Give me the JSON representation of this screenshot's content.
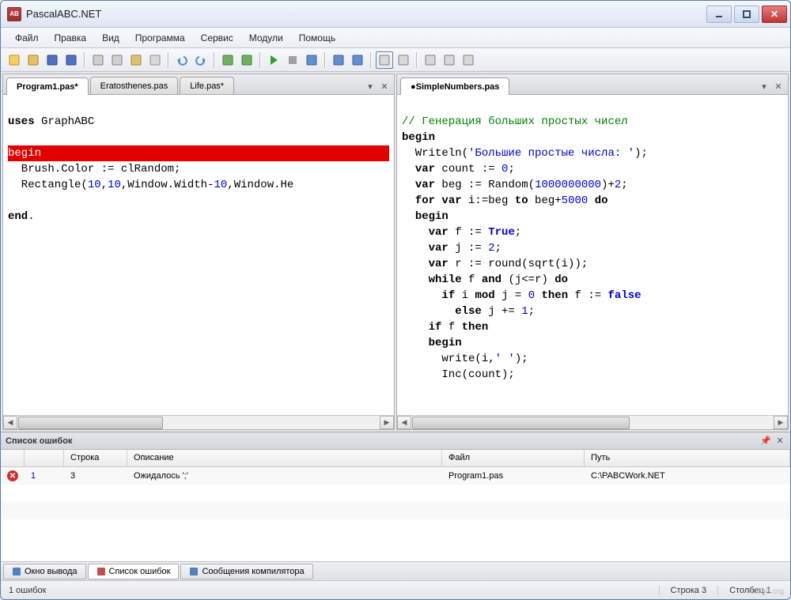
{
  "title": "PascalABC.NET",
  "menu": [
    "Файл",
    "Правка",
    "Вид",
    "Программа",
    "Сервис",
    "Модули",
    "Помощь"
  ],
  "toolbar_icons": [
    {
      "name": "new-file-icon",
      "fill": "#f4d060",
      "stroke": "#c09020"
    },
    {
      "name": "open-icon",
      "fill": "#e8c060",
      "stroke": "#b08020"
    },
    {
      "name": "save-icon",
      "fill": "#5070c0",
      "stroke": "#304090"
    },
    {
      "name": "save-all-icon",
      "fill": "#5070c0",
      "stroke": "#304090"
    },
    {
      "sep": true
    },
    {
      "name": "cut-icon",
      "fill": "#d0d0d0",
      "stroke": "#808080"
    },
    {
      "name": "copy-icon",
      "fill": "#d0d0d0",
      "stroke": "#808080"
    },
    {
      "name": "paste-icon",
      "fill": "#e0c070",
      "stroke": "#a08040"
    },
    {
      "name": "duplicate-icon",
      "fill": "#d8d8d8",
      "stroke": "#909090"
    },
    {
      "sep": true
    },
    {
      "name": "undo-icon",
      "fill": "#5090d0",
      "stroke": "#306090"
    },
    {
      "name": "redo-icon",
      "fill": "#5090d0",
      "stroke": "#306090"
    },
    {
      "sep": true
    },
    {
      "name": "compile-icon",
      "fill": "#70b060",
      "stroke": "#408030"
    },
    {
      "name": "build-icon",
      "fill": "#70b060",
      "stroke": "#408030"
    },
    {
      "sep": true
    },
    {
      "name": "run-icon",
      "fill": "#30a030",
      "stroke": "#207020"
    },
    {
      "name": "stop-icon",
      "fill": "#a0a0a0",
      "stroke": "#707070"
    },
    {
      "name": "step-icon",
      "fill": "#6090d0",
      "stroke": "#406090"
    },
    {
      "sep": true
    },
    {
      "name": "step-into-icon",
      "fill": "#6090d0",
      "stroke": "#406090"
    },
    {
      "name": "step-over-icon",
      "fill": "#6090d0",
      "stroke": "#406090"
    },
    {
      "sep": true
    },
    {
      "name": "console-icon",
      "fill": "#d8d8d8",
      "stroke": "#808080",
      "boxed": true
    },
    {
      "name": "form-icon",
      "fill": "#d8d8d8",
      "stroke": "#808080"
    },
    {
      "sep": true
    },
    {
      "name": "page1-icon",
      "fill": "#d8d8d8",
      "stroke": "#808080"
    },
    {
      "name": "page2-icon",
      "fill": "#d8d8d8",
      "stroke": "#808080"
    },
    {
      "name": "page3-icon",
      "fill": "#d8d8d8",
      "stroke": "#808080"
    }
  ],
  "left_tabs": [
    {
      "label": "Program1.pas*",
      "active": true
    },
    {
      "label": "Eratosthenes.pas",
      "active": false
    },
    {
      "label": "Life.pas*",
      "active": false
    }
  ],
  "right_tabs": [
    {
      "label": "●SimpleNumbers.pas",
      "active": true
    }
  ],
  "left_code": {
    "l1": "uses GraphABC",
    "l2": "",
    "l3": "begin",
    "l4": "  Brush.Color := clRandom;",
    "l5": "  Rectangle(10,10,Window.Width-10,Window.He",
    "l6": "",
    "l7": "end."
  },
  "right_code": {
    "comment": "// Генерация больших простых чисел",
    "l2": "begin",
    "l3_a": "  Writeln(",
    "l3_s": "'Большие простые числа: '",
    "l3_b": ");",
    "l4_a": "  ",
    "l4_kw": "var",
    "l4_b": " count := ",
    "l4_n": "0",
    "l4_c": ";",
    "l5_a": "  ",
    "l5_kw": "var",
    "l5_b": " beg := Random(",
    "l5_n": "1000000000",
    "l5_c": ")+",
    "l5_n2": "2",
    "l5_d": ";",
    "l6_a": "  ",
    "l6_kw": "for var",
    "l6_b": " i:=beg ",
    "l6_kw2": "to",
    "l6_c": " beg+",
    "l6_n": "5000",
    "l6_d": " ",
    "l6_kw3": "do",
    "l7": "  begin",
    "l8_a": "    ",
    "l8_kw": "var",
    "l8_b": " f := ",
    "l8_v": "True",
    "l8_c": ";",
    "l9_a": "    ",
    "l9_kw": "var",
    "l9_b": " j := ",
    "l9_n": "2",
    "l9_c": ";",
    "l10_a": "    ",
    "l10_kw": "var",
    "l10_b": " r := round(sqrt(i));",
    "l11_a": "    ",
    "l11_kw": "while",
    "l11_b": " f ",
    "l11_kw2": "and",
    "l11_c": " (j<=r) ",
    "l11_kw3": "do",
    "l12_a": "      ",
    "l12_kw": "if",
    "l12_b": " i ",
    "l12_kw2": "mod",
    "l12_c": " j = ",
    "l12_n": "0",
    "l12_d": " ",
    "l12_kw3": "then",
    "l12_e": " f := ",
    "l12_v": "false",
    "l13_a": "        ",
    "l13_kw": "else",
    "l13_b": " j += ",
    "l13_n": "1",
    "l13_c": ";",
    "l14_a": "    ",
    "l14_kw": "if",
    "l14_b": " f ",
    "l14_kw2": "then",
    "l15": "    begin",
    "l16_a": "      write(i,",
    "l16_s": "' '",
    "l16_b": ");",
    "l17": "      Inc(count);"
  },
  "errors_panel": {
    "title": "Список ошибок",
    "columns": {
      "line": "Строка",
      "desc": "Описание",
      "file": "Файл",
      "path": "Путь"
    },
    "rows": [
      {
        "num": "1",
        "line": "3",
        "desc": "Ожидалось ';'",
        "file": "Program1.pas",
        "path": "C:\\PABCWork.NET"
      }
    ]
  },
  "bottom_tabs": [
    {
      "label": "Окно вывода",
      "active": false,
      "icon": "output-icon",
      "color": "#5080c0"
    },
    {
      "label": "Список ошибок",
      "active": true,
      "icon": "errors-icon",
      "color": "#c05050"
    },
    {
      "label": "Сообщения компилятора",
      "active": false,
      "icon": "messages-icon",
      "color": "#5080c0"
    }
  ],
  "status": {
    "left": "1 ошибок",
    "line": "Строка  3",
    "col": "Столбец  1"
  },
  "watermark": "ruload.org"
}
